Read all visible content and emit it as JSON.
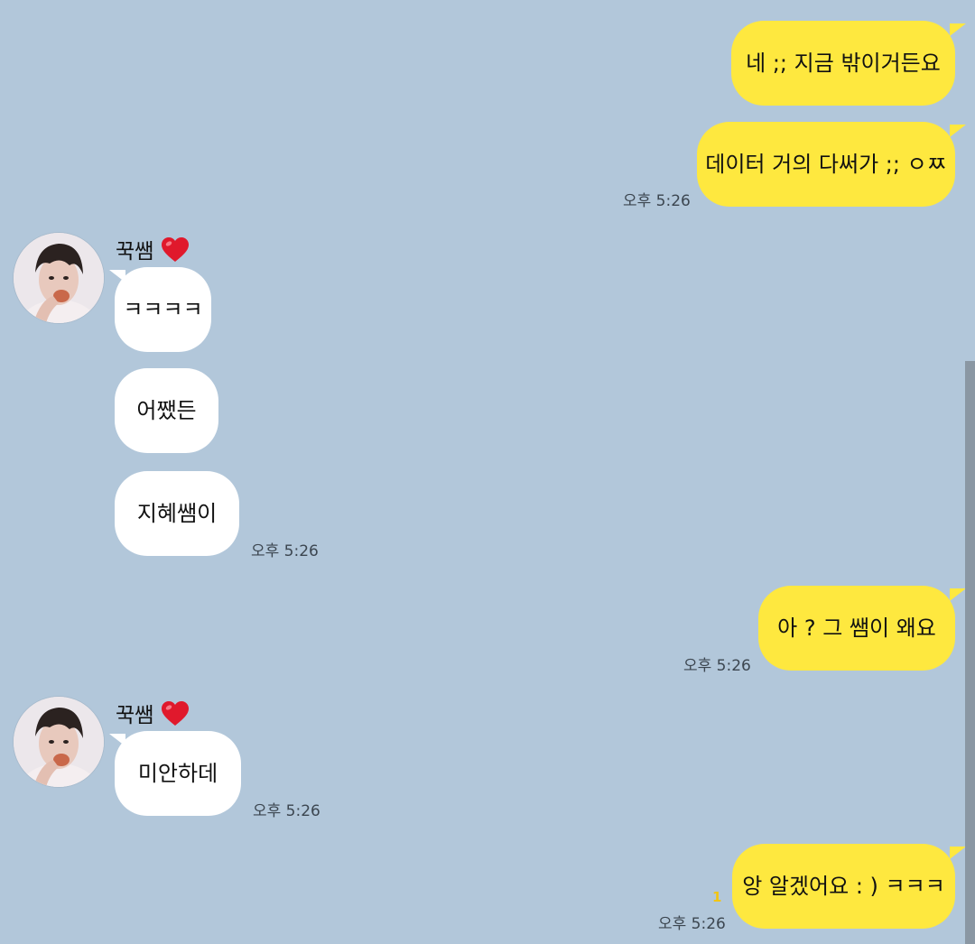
{
  "colors": {
    "background": "#b2c7da",
    "my_bubble": "#fee83f",
    "their_bubble": "#ffffff",
    "unread": "#f2c511"
  },
  "contact": {
    "name": "꾹쌤",
    "name_icon": "heart-icon",
    "avatar_icon": "profile-photo"
  },
  "messages": [
    {
      "sender": "me",
      "text": "네 ;; 지금 밖이거든요"
    },
    {
      "sender": "me",
      "text": "데이터 거의 다써가 ;; ㅇㅉ",
      "time": "오후 5:26"
    },
    {
      "sender": "them",
      "text": "ㅋㅋㅋㅋ"
    },
    {
      "sender": "them",
      "text": "어쨌든"
    },
    {
      "sender": "them",
      "text": "지혜쌤이",
      "time": "오후 5:26"
    },
    {
      "sender": "me",
      "text": "아 ? 그 쌤이 왜요",
      "time": "오후 5:26"
    },
    {
      "sender": "them",
      "text": "미안하데",
      "time": "오후 5:26"
    },
    {
      "sender": "me",
      "text": "앙 알겠어요 : )  ㅋㅋㅋ",
      "time": "오후 5:26",
      "unread": "1"
    }
  ]
}
